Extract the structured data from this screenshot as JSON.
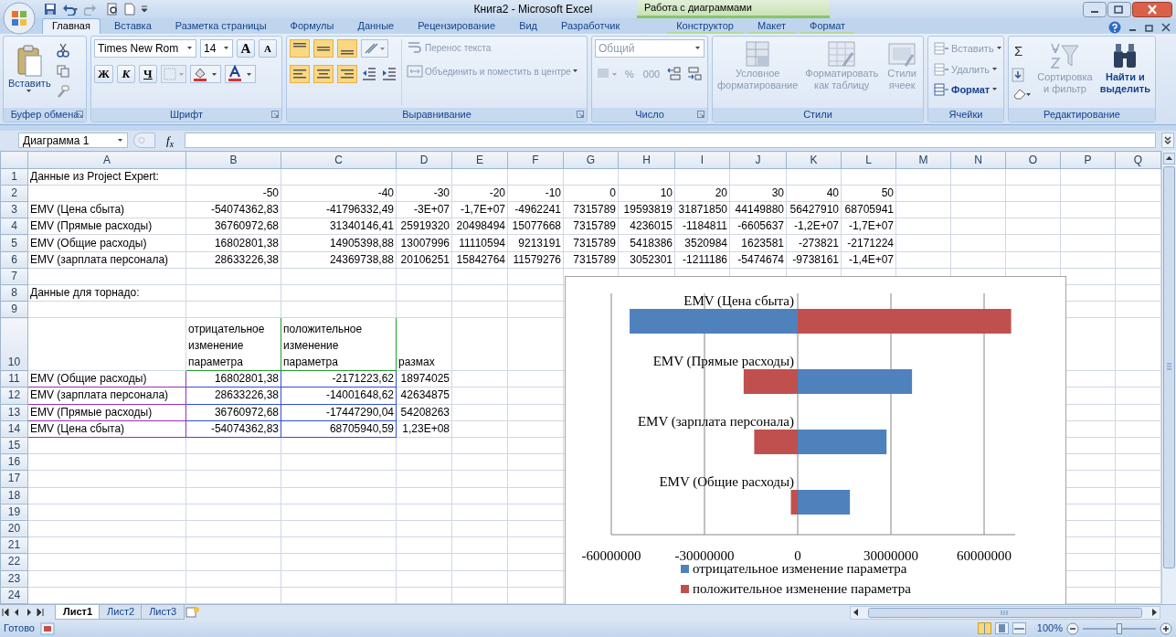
{
  "window": {
    "title": "Книга2 - Microsoft Excel",
    "context_title": "Работа с диаграммами"
  },
  "tabs": [
    {
      "label": "Главная",
      "selected": true,
      "contextual": false
    },
    {
      "label": "Вставка",
      "selected": false,
      "contextual": false
    },
    {
      "label": "Разметка страницы",
      "selected": false,
      "contextual": false
    },
    {
      "label": "Формулы",
      "selected": false,
      "contextual": false
    },
    {
      "label": "Данные",
      "selected": false,
      "contextual": false
    },
    {
      "label": "Рецензирование",
      "selected": false,
      "contextual": false
    },
    {
      "label": "Вид",
      "selected": false,
      "contextual": false
    },
    {
      "label": "Разработчик",
      "selected": false,
      "contextual": false
    },
    {
      "label": "Конструктор",
      "selected": false,
      "contextual": true
    },
    {
      "label": "Макет",
      "selected": false,
      "contextual": true
    },
    {
      "label": "Формат",
      "selected": false,
      "contextual": true
    }
  ],
  "ribbon": {
    "clipboard": {
      "label": "Буфер обмена",
      "paste": "Вставить"
    },
    "font": {
      "label": "Шрифт",
      "font_name": "Times New Rom",
      "font_size": "14",
      "grow": "A",
      "shrink": "A",
      "bold": "Ж",
      "italic": "К",
      "underline": "Ч"
    },
    "alignment": {
      "label": "Выравнивание",
      "buttons": [
        {
          "label": "Перенос текста",
          "disabled": true
        },
        {
          "label": "Объединить и поместить в центре",
          "disabled": true
        }
      ]
    },
    "number": {
      "label": "Число",
      "format": "Общий",
      "disabled": true,
      "percent": "%",
      "thousands": "000"
    },
    "styles": {
      "label": "Стили",
      "buttons": [
        {
          "label": "Условное форматирование",
          "disabled": true
        },
        {
          "label": "Форматировать как таблицу",
          "disabled": true
        },
        {
          "label": "Стили ячеек",
          "disabled": true
        }
      ]
    },
    "cells": {
      "label": "Ячейки",
      "buttons": [
        {
          "label": "Вставить",
          "disabled": true
        },
        {
          "label": "Удалить",
          "disabled": true
        },
        {
          "label": "Формат",
          "disabled": false
        }
      ]
    },
    "editing": {
      "label": "Редактирование",
      "sigma": "Σ",
      "buttons": [
        {
          "label": "Сортировка и фильтр",
          "disabled": true
        },
        {
          "label": "Найти и выделить",
          "disabled": false
        }
      ]
    }
  },
  "formula_bar": {
    "name_box": "Диаграмма 1",
    "fx": "f$_{x}$"
  },
  "columns": [
    "A",
    "B",
    "C",
    "D",
    "E",
    "F",
    "G",
    "H",
    "I",
    "J",
    "K",
    "L",
    "M",
    "N",
    "O",
    "P",
    "Q"
  ],
  "rows": [
    {
      "number": "1",
      "cells": {
        "A": {
          "text": "Данные из Project Expert:",
          "kind": "text"
        }
      }
    },
    {
      "number": "2",
      "cells": {
        "B": {
          "text": "-50",
          "kind": "number"
        },
        "C": {
          "text": "-40",
          "kind": "number"
        },
        "D": {
          "text": "-30",
          "kind": "number"
        },
        "E": {
          "text": "-20",
          "kind": "number"
        },
        "F": {
          "text": "-10",
          "kind": "number"
        },
        "G": {
          "text": "0",
          "kind": "number"
        },
        "H": {
          "text": "10",
          "kind": "number"
        },
        "I": {
          "text": "20",
          "kind": "number"
        },
        "J": {
          "text": "30",
          "kind": "number"
        },
        "K": {
          "text": "40",
          "kind": "number"
        },
        "L": {
          "text": "50",
          "kind": "number"
        }
      }
    },
    {
      "number": "3",
      "cells": {
        "A": {
          "text": "EMV (Цена сбыта)",
          "kind": "text"
        },
        "B": {
          "text": "-54074362,83",
          "kind": "number"
        },
        "C": {
          "text": "-41796332,49",
          "kind": "number"
        },
        "D": {
          "text": "-3E+07",
          "kind": "number"
        },
        "E": {
          "text": "-1,7E+07",
          "kind": "number"
        },
        "F": {
          "text": "-4962241",
          "kind": "number"
        },
        "G": {
          "text": "7315789",
          "kind": "number"
        },
        "H": {
          "text": "19593819",
          "kind": "number"
        },
        "I": {
          "text": "31871850",
          "kind": "number"
        },
        "J": {
          "text": "44149880",
          "kind": "number"
        },
        "K": {
          "text": "56427910",
          "kind": "number"
        },
        "L": {
          "text": "68705941",
          "kind": "number"
        }
      }
    },
    {
      "number": "4",
      "cells": {
        "A": {
          "text": "EMV (Прямые расходы)",
          "kind": "text"
        },
        "B": {
          "text": "36760972,68",
          "kind": "number"
        },
        "C": {
          "text": "31340146,41",
          "kind": "number"
        },
        "D": {
          "text": "25919320",
          "kind": "number"
        },
        "E": {
          "text": "20498494",
          "kind": "number"
        },
        "F": {
          "text": "15077668",
          "kind": "number"
        },
        "G": {
          "text": "7315789",
          "kind": "number"
        },
        "H": {
          "text": "4236015",
          "kind": "number"
        },
        "I": {
          "text": "-1184811",
          "kind": "number"
        },
        "J": {
          "text": "-6605637",
          "kind": "number"
        },
        "K": {
          "text": "-1,2E+07",
          "kind": "number"
        },
        "L": {
          "text": "-1,7E+07",
          "kind": "number"
        }
      }
    },
    {
      "number": "5",
      "cells": {
        "A": {
          "text": "EMV (Общие расходы)",
          "kind": "text"
        },
        "B": {
          "text": "16802801,38",
          "kind": "number"
        },
        "C": {
          "text": "14905398,88",
          "kind": "number"
        },
        "D": {
          "text": "13007996",
          "kind": "number"
        },
        "E": {
          "text": "11110594",
          "kind": "number"
        },
        "F": {
          "text": "9213191",
          "kind": "number"
        },
        "G": {
          "text": "7315789",
          "kind": "number"
        },
        "H": {
          "text": "5418386",
          "kind": "number"
        },
        "I": {
          "text": "3520984",
          "kind": "number"
        },
        "J": {
          "text": "1623581",
          "kind": "number"
        },
        "K": {
          "text": "-273821",
          "kind": "number"
        },
        "L": {
          "text": "-2171224",
          "kind": "number"
        }
      }
    },
    {
      "number": "6",
      "cells": {
        "A": {
          "text": "EMV (зарплата персонала)",
          "kind": "text"
        },
        "B": {
          "text": "28633226,38",
          "kind": "number"
        },
        "C": {
          "text": "24369738,88",
          "kind": "number"
        },
        "D": {
          "text": "20106251",
          "kind": "number"
        },
        "E": {
          "text": "15842764",
          "kind": "number"
        },
        "F": {
          "text": "11579276",
          "kind": "number"
        },
        "G": {
          "text": "7315789",
          "kind": "number"
        },
        "H": {
          "text": "3052301",
          "kind": "number"
        },
        "I": {
          "text": "-1211186",
          "kind": "number"
        },
        "J": {
          "text": "-5474674",
          "kind": "number"
        },
        "K": {
          "text": "-9738161",
          "kind": "number"
        },
        "L": {
          "text": "-1,4E+07",
          "kind": "number"
        }
      }
    },
    {
      "number": "7"
    },
    {
      "number": "8",
      "cells": {
        "A": {
          "text": "Данные для торнадо:",
          "kind": "text"
        }
      }
    },
    {
      "number": "9"
    },
    {
      "number": "10",
      "tall": true,
      "cells": {
        "B": {
          "text": "отрицательное изменение параметра",
          "kind": "text",
          "color": "#1e9e2e"
        },
        "C": {
          "text": "положительное изменение параметра",
          "kind": "text",
          "color": "#1e9e2e"
        },
        "D": {
          "text": "размах",
          "kind": "text"
        }
      }
    },
    {
      "number": "11",
      "cells": {
        "A": {
          "text": "EMV (Общие расходы)",
          "kind": "text",
          "color": "#9b2fb0"
        },
        "B": {
          "text": "16802801,38",
          "kind": "number",
          "color": "#2f4fd8"
        },
        "C": {
          "text": "-2171223,62",
          "kind": "number",
          "color": "#2f4fd8"
        },
        "D": {
          "text": "18974025",
          "kind": "number"
        }
      }
    },
    {
      "number": "12",
      "cells": {
        "A": {
          "text": "EMV (зарплата персонала)",
          "kind": "text",
          "color": "#9b2fb0"
        },
        "B": {
          "text": "28633226,38",
          "kind": "number",
          "color": "#2f4fd8"
        },
        "C": {
          "text": "-14001648,62",
          "kind": "number",
          "color": "#2f4fd8"
        },
        "D": {
          "text": "42634875",
          "kind": "number"
        }
      }
    },
    {
      "number": "13",
      "cells": {
        "A": {
          "text": "EMV (Прямые расходы)",
          "kind": "text",
          "color": "#9b2fb0"
        },
        "B": {
          "text": "36760972,68",
          "kind": "number",
          "color": "#2f4fd8"
        },
        "C": {
          "text": "-17447290,04",
          "kind": "number",
          "color": "#2f4fd8"
        },
        "D": {
          "text": "54208263",
          "kind": "number"
        }
      }
    },
    {
      "number": "14",
      "cells": {
        "A": {
          "text": "EMV (Цена сбыта)",
          "kind": "text",
          "color": "#9b2fb0"
        },
        "B": {
          "text": "-54074362,83",
          "kind": "number",
          "color": "#2f4fd8"
        },
        "C": {
          "text": "68705940,59",
          "kind": "number",
          "color": "#2f4fd8"
        },
        "D": {
          "text": "1,23E+08",
          "kind": "number"
        }
      }
    },
    {
      "number": "15"
    },
    {
      "number": "16"
    },
    {
      "number": "17"
    },
    {
      "number": "18"
    },
    {
      "number": "19"
    },
    {
      "number": "20"
    },
    {
      "number": "21"
    },
    {
      "number": "22"
    },
    {
      "number": "23"
    },
    {
      "number": "24"
    }
  ],
  "chart": {
    "chart_data": {
      "type": "bar",
      "orientation": "horizontal",
      "stacked": true,
      "grid": true,
      "legend": true,
      "xlim": [
        -60000000,
        70000000
      ],
      "categories": [
        "EMV (Цена сбыта)",
        "EMV (Прямые расходы)",
        "EMV (зарплата персонала)",
        "EMV (Общие расходы)"
      ],
      "series": [
        {
          "name": "отрицательное изменение параметра",
          "color": "#4f81bd",
          "values": [
            -54100000,
            36800000,
            28600000,
            16800000
          ]
        },
        {
          "name": "положительное изменение параметра",
          "color": "#c0504d",
          "values": [
            68700000,
            -17400000,
            -14000000,
            -2200000
          ]
        }
      ],
      "xticks": [
        {
          "value": -60000000,
          "label": "-60000000"
        },
        {
          "value": -30000000,
          "label": "-30000000"
        },
        {
          "value": 0,
          "label": "0"
        },
        {
          "value": 30000000,
          "label": "30000000"
        },
        {
          "value": 60000000,
          "label": "60000000"
        }
      ]
    }
  },
  "sheet_tabs": [
    {
      "label": "Лист1",
      "selected": true
    },
    {
      "label": "Лист2",
      "selected": false
    },
    {
      "label": "Лист3",
      "selected": false
    }
  ],
  "status_bar": {
    "text": "Готово",
    "views": [
      {
        "kind": "normal",
        "selected": true
      },
      {
        "kind": "page_layout",
        "selected": false
      },
      {
        "kind": "page_break",
        "selected": false
      }
    ],
    "zoom": "100%",
    "zoom_slider": {
      "level": 0.5
    }
  }
}
